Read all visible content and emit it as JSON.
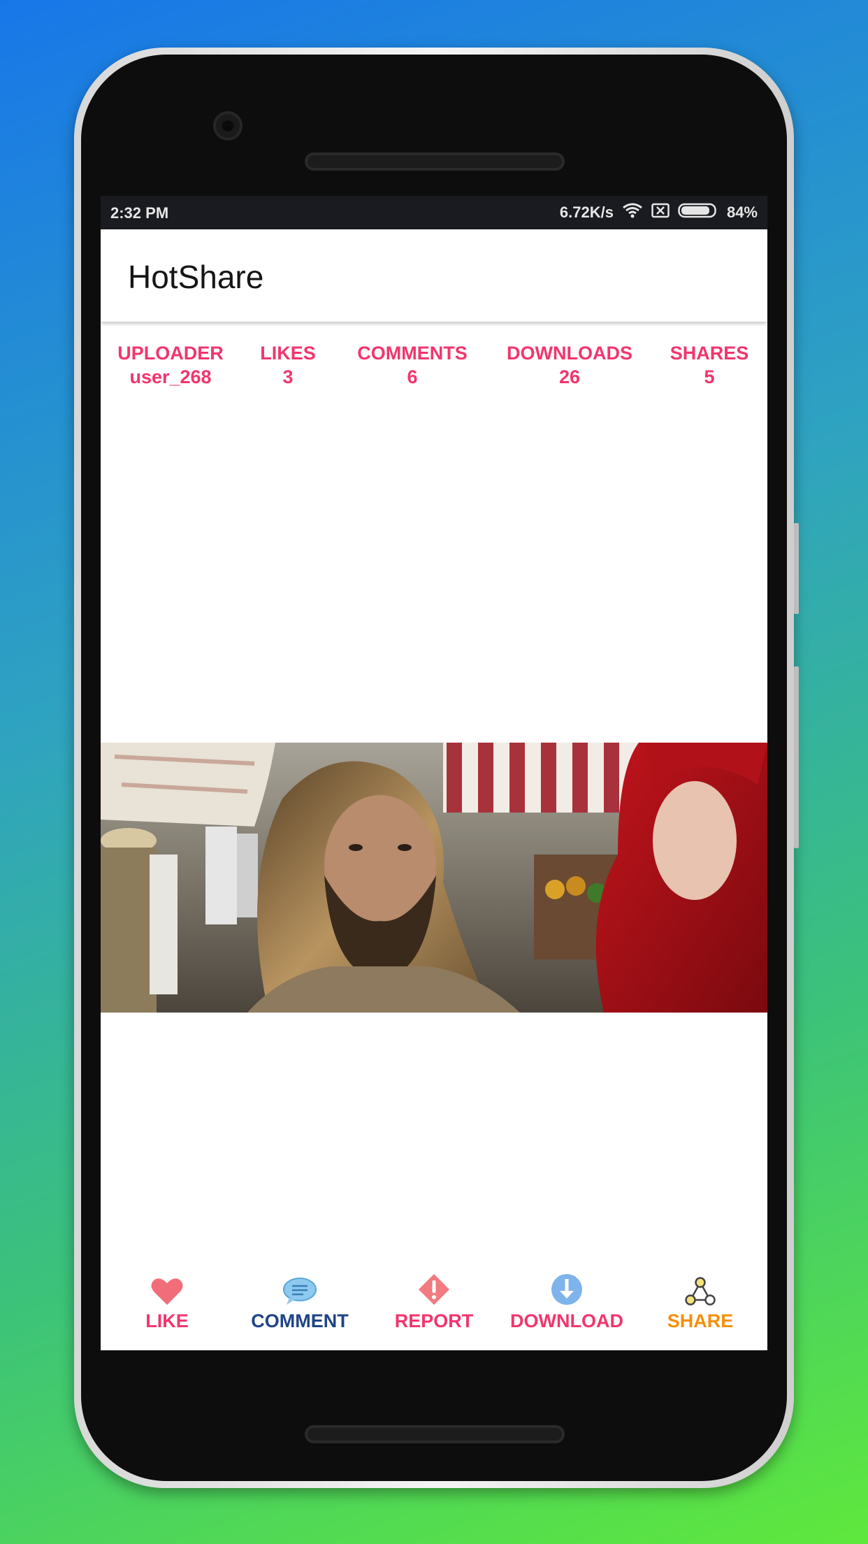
{
  "status_bar": {
    "time": "2:32 PM",
    "speed": "6.72K/s",
    "battery": "84%"
  },
  "app": {
    "title": "HotShare"
  },
  "stats": [
    {
      "label": "UPLOADER",
      "value": "user_268"
    },
    {
      "label": "LIKES",
      "value": "3"
    },
    {
      "label": "COMMENTS",
      "value": "6"
    },
    {
      "label": "DOWNLOADS",
      "value": "26"
    },
    {
      "label": "SHARES",
      "value": "5"
    }
  ],
  "actions": [
    {
      "label": "LIKE",
      "icon": "heart-icon",
      "color": "#f2356d"
    },
    {
      "label": "COMMENT",
      "icon": "speech-bubble-icon",
      "color": "#1f4488"
    },
    {
      "label": "REPORT",
      "icon": "warning-icon",
      "color": "#f2356d"
    },
    {
      "label": "DOWNLOAD",
      "icon": "download-icon",
      "color": "#f2356d"
    },
    {
      "label": "SHARE",
      "icon": "share-nodes-icon",
      "color": "#f5900a"
    }
  ],
  "colors": {
    "stats_text": "#f2356d",
    "status_bar_bg": "#1a1b20"
  }
}
